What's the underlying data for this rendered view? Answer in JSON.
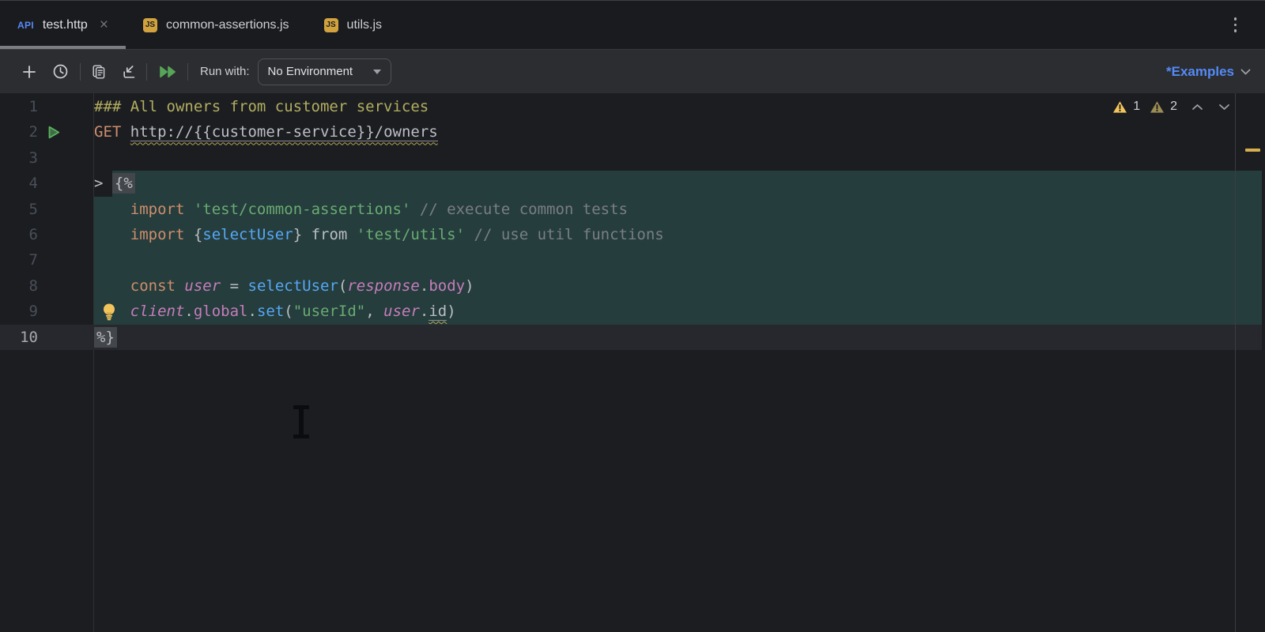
{
  "tabs": {
    "close_glyph": "×",
    "items": [
      {
        "label": "test.http",
        "icon": "http-file",
        "icon_label": "API",
        "active": true
      },
      {
        "label": "common-assertions.js",
        "icon": "js-file",
        "icon_label": "JS",
        "active": false
      },
      {
        "label": "utils.js",
        "icon": "js-file",
        "icon_label": "JS",
        "active": false
      }
    ]
  },
  "toolbar": {
    "icons": [
      "add",
      "history",
      "request-examples",
      "import-requests",
      "run-all-requests"
    ],
    "run_with_label": "Run with:",
    "environment_value": "No Environment",
    "examples_label": "*Examples"
  },
  "editor": {
    "warnings": {
      "strong_count": "1",
      "weak_count": "2"
    },
    "lines": [
      {
        "num": "1",
        "tokens": [
          {
            "c": "sec",
            "t": "### All owners from customer services"
          }
        ]
      },
      {
        "num": "2",
        "gutter_icon": "run",
        "tokens": [
          {
            "c": "kw",
            "t": "GET"
          },
          {
            "c": "d",
            "t": " "
          },
          {
            "c": "url",
            "t": "http://{{customer-service}}/owners"
          }
        ]
      },
      {
        "num": "3",
        "tokens": []
      },
      {
        "num": "4",
        "teal": true,
        "prefix": [
          {
            "c": "d",
            "t": "> "
          }
        ],
        "tokens": [
          {
            "c": "box",
            "t": "{%"
          }
        ]
      },
      {
        "num": "5",
        "teal": true,
        "tokens": [
          {
            "c": "d",
            "t": "    "
          },
          {
            "c": "kw",
            "t": "import"
          },
          {
            "c": "d",
            "t": " "
          },
          {
            "c": "str",
            "t": "'test/common-assertions'"
          },
          {
            "c": "d",
            "t": " "
          },
          {
            "c": "com",
            "t": "// execute common tests"
          }
        ]
      },
      {
        "num": "6",
        "teal": true,
        "tokens": [
          {
            "c": "d",
            "t": "    "
          },
          {
            "c": "kw",
            "t": "import"
          },
          {
            "c": "d",
            "t": " {"
          },
          {
            "c": "fn",
            "t": "selectUser"
          },
          {
            "c": "d",
            "t": "} from "
          },
          {
            "c": "str",
            "t": "'test/utils'"
          },
          {
            "c": "d",
            "t": " "
          },
          {
            "c": "com",
            "t": "// use util functions"
          }
        ]
      },
      {
        "num": "7",
        "teal": true,
        "tokens": []
      },
      {
        "num": "8",
        "teal": true,
        "tokens": [
          {
            "c": "d",
            "t": "    "
          },
          {
            "c": "kw",
            "t": "const"
          },
          {
            "c": "d",
            "t": " "
          },
          {
            "c": "var",
            "t": "user"
          },
          {
            "c": "d",
            "t": " = "
          },
          {
            "c": "fn",
            "t": "selectUser"
          },
          {
            "c": "d",
            "t": "("
          },
          {
            "c": "var",
            "t": "response"
          },
          {
            "c": "d",
            "t": "."
          },
          {
            "c": "prop",
            "t": "body"
          },
          {
            "c": "d",
            "t": ")"
          }
        ]
      },
      {
        "num": "9",
        "teal": true,
        "bulb": true,
        "tokens": [
          {
            "c": "d",
            "t": "    "
          },
          {
            "c": "var",
            "t": "client"
          },
          {
            "c": "d",
            "t": "."
          },
          {
            "c": "prop",
            "t": "global"
          },
          {
            "c": "d",
            "t": "."
          },
          {
            "c": "fn",
            "t": "set"
          },
          {
            "c": "d",
            "t": "("
          },
          {
            "c": "str",
            "t": "\"userId\""
          },
          {
            "c": "d",
            "t": ", "
          },
          {
            "c": "var",
            "t": "user"
          },
          {
            "c": "d",
            "t": "."
          },
          {
            "c": "warn",
            "t": "id"
          },
          {
            "c": "d",
            "t": ")"
          }
        ]
      },
      {
        "num": "10",
        "highlight": true,
        "tokens": [
          {
            "c": "box",
            "t": "%}"
          }
        ]
      }
    ]
  },
  "colors": {
    "accent_blue": "#548AF7",
    "warning_strong": "#F2C55C",
    "warning_weak": "#9C8D55",
    "run_green": "#57A558",
    "keyword_orange": "#CF8E6D",
    "string_green": "#6AAB73",
    "function_blue": "#56A8F5",
    "variable_purple": "#C77DBB",
    "comment_gray": "#7A7E85",
    "section_yellow": "#B3AE60",
    "injected_fragment_bg": "#253D3D"
  }
}
